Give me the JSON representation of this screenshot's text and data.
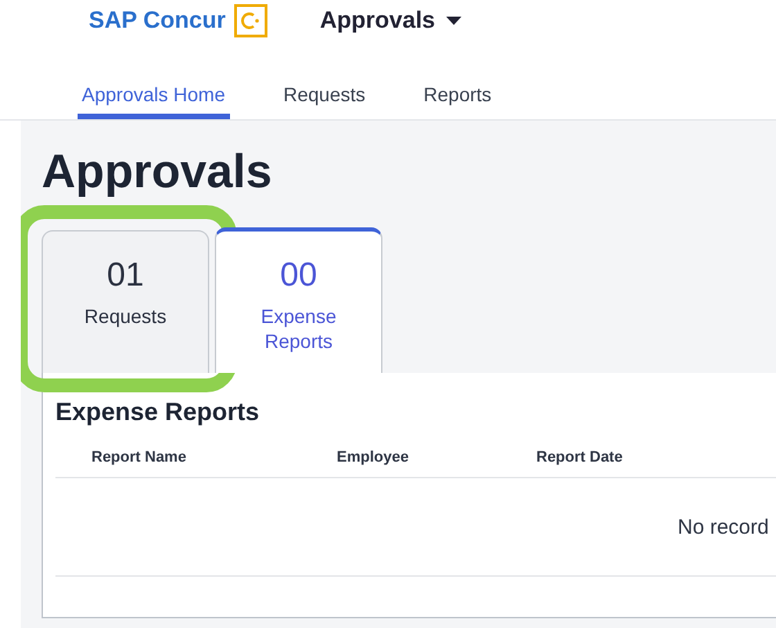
{
  "header": {
    "brand": "SAP Concur",
    "module_menu": "Approvals"
  },
  "nav_tabs": [
    {
      "label": "Approvals Home",
      "selected": true
    },
    {
      "label": "Requests",
      "selected": false
    },
    {
      "label": "Reports",
      "selected": false
    }
  ],
  "page_title": "Approvals",
  "tiles": [
    {
      "count": "01",
      "label": "Requests",
      "selected": false,
      "highlighted": true
    },
    {
      "count": "00",
      "label": "Expense Reports",
      "selected": true,
      "highlighted": false
    }
  ],
  "panel": {
    "title": "Expense Reports",
    "table": {
      "columns": [
        "Report Name",
        "Employee",
        "Report Date"
      ],
      "empty_message": "No record"
    }
  }
}
